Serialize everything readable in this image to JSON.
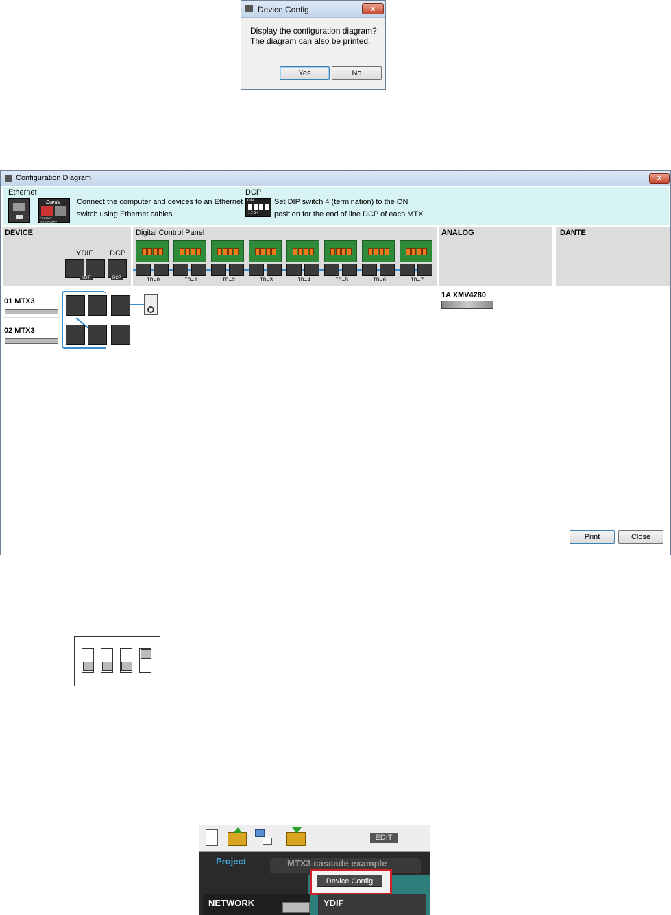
{
  "device_config_dialog": {
    "title": "Device Config",
    "message_line1": "Display the configuration diagram?",
    "message_line2": "The diagram can also be printed.",
    "yes_label": "Yes",
    "no_label": "No",
    "close_label": "x"
  },
  "config_diagram": {
    "title": "Configuration Diagram",
    "close_label": "x",
    "legend": {
      "ethernet_heading": "Ethernet",
      "ethernet_text1": "Connect the computer and devices to an Ethernet",
      "ethernet_text2": "switch using Ethernet cables.",
      "dante_logo_text": "Dante",
      "dante_sub_text": "PRIMARY  SECONDARY",
      "dcp_heading": "DCP",
      "dcp_text1": "Set DIP switch 4 (termination) to the ON",
      "dcp_text2": "position for the end of line DCP of each MTX.",
      "dip_on": "ON",
      "dip_nums": "1 2 3 4"
    },
    "columns": {
      "device": "DEVICE",
      "dcp_panel": "Digital Control Panel",
      "analog": "ANALOG",
      "dante": "DANTE",
      "ydif": "YDIF",
      "dcp": "DCP",
      "ydif_tag": "YDIF",
      "dcp_tag": "DCP",
      "in_tag": "IN",
      "out_tag": "OUT"
    },
    "dcp_ids": [
      "ID=0",
      "ID=1",
      "ID=2",
      "ID=3",
      "ID=4",
      "ID=5",
      "ID=6",
      "ID=7"
    ],
    "devices": [
      {
        "name": "01 MTX3"
      },
      {
        "name": "02 MTX3"
      }
    ],
    "analog_device": "1A XMV4280",
    "print_label": "Print",
    "close_button_label": "Close"
  },
  "toolbar": {
    "edit_label": "EDIT",
    "project_tab": "Project",
    "project_name": "MTX3 cascade example",
    "device_config_button": "Device Config",
    "network_label": "NETWORK",
    "ydif_label": "YDIF"
  },
  "colors": {
    "legend_bg": "#d8f3f3",
    "dcp_green": "#2f8a3a",
    "dip_orange": "#f07a1a",
    "cable_blue": "#3a8fd0",
    "highlight_red": "#d0202a",
    "app_dark": "#2a2a2a",
    "app_teal": "#2d7f7c"
  }
}
